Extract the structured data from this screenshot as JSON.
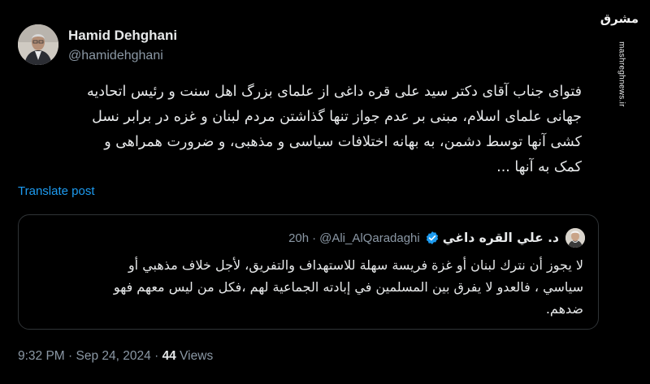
{
  "author": {
    "name": "Hamid Dehghani",
    "handle": "@hamidehghani"
  },
  "watermark": {
    "logo_text": "مشرق",
    "url": "mashreghnews.ir"
  },
  "tweet": {
    "text": "فتوای جناب آقای دکتر سید علی قره داغی از علمای بزرگ اهل سنت و رئیس اتحادیه\nجهانی علمای اسلام، مبنی بر عدم جواز تنها گذاشتن مردم لبنان و غزه در برابر نسل\nکشی آنها توسط دشمن، به بهانه اختلافات سیاسی و مذهبی، و ضرورت همراهی و\nکمک به آنها ...",
    "translate_label": "Translate post"
  },
  "quote": {
    "name": "د. علي القره داغي",
    "handle": "@Ali_AlQaradaghi",
    "separator": "·",
    "time": "20h",
    "text": "لا يجوز أن نترك لبنان أو غزة فريسة سهلة للاستهداف والتفريق، لأجل خلاف مذهبي أو\nسياسي ، فالعدو لا يفرق بين المسلمين في إبادته الجماعية لهم ،فكل من ليس معهم فهو\nضدهم."
  },
  "meta": {
    "time": "9:32 PM",
    "sep1": "·",
    "date": "Sep 24, 2024",
    "sep2": "·",
    "views_count": "44",
    "views_label": "Views"
  },
  "colors": {
    "background": "#000000",
    "text": "#e7e9ea",
    "secondary": "#8b98a5",
    "link": "#1d9bf0",
    "border": "#2f3336"
  }
}
